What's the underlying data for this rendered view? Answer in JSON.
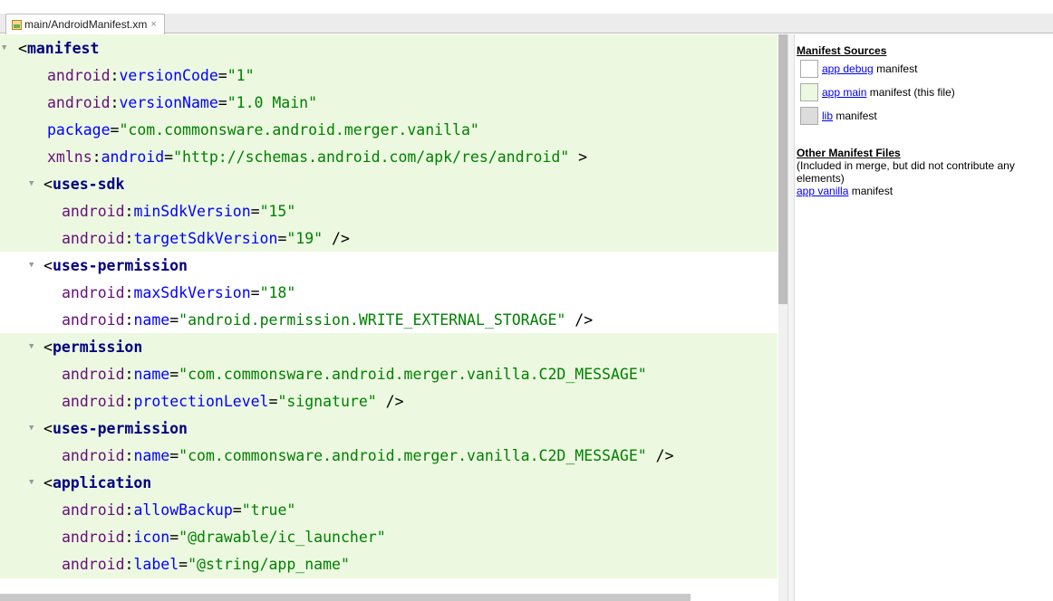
{
  "tab": {
    "title": "main/AndroidManifest.xm",
    "close": "×",
    "icon": "xml-file-icon"
  },
  "code_lines": [
    {
      "bg": "green",
      "fold": true,
      "indent": 0,
      "tokens": [
        {
          "t": "pl",
          "s": "<"
        },
        {
          "t": "tag",
          "s": "manifest"
        }
      ]
    },
    {
      "bg": "green",
      "indent": 1,
      "tokens": [
        {
          "t": "ns",
          "s": "android"
        },
        {
          "t": "pl",
          "s": ":"
        },
        {
          "t": "attr",
          "s": "versionCode"
        },
        {
          "t": "pl",
          "s": "="
        },
        {
          "t": "val",
          "s": "\"1\""
        }
      ]
    },
    {
      "bg": "green",
      "indent": 1,
      "tokens": [
        {
          "t": "ns",
          "s": "android"
        },
        {
          "t": "pl",
          "s": ":"
        },
        {
          "t": "attr",
          "s": "versionName"
        },
        {
          "t": "pl",
          "s": "="
        },
        {
          "t": "val",
          "s": "\"1.0 Main\""
        }
      ]
    },
    {
      "bg": "green",
      "indent": 1,
      "tokens": [
        {
          "t": "attr",
          "s": "package"
        },
        {
          "t": "pl",
          "s": "="
        },
        {
          "t": "val",
          "s": "\"com.commonsware.android.merger.vanilla\""
        }
      ]
    },
    {
      "bg": "green",
      "indent": 1,
      "tokens": [
        {
          "t": "ns",
          "s": "xmlns"
        },
        {
          "t": "pl",
          "s": ":"
        },
        {
          "t": "attr",
          "s": "android"
        },
        {
          "t": "pl",
          "s": "="
        },
        {
          "t": "val",
          "s": "\"http://schemas.android.com/apk/res/android\""
        },
        {
          "t": "pl",
          "s": " >"
        }
      ]
    },
    {
      "bg": "green",
      "fold": true,
      "indent": 1,
      "tokens": [
        {
          "t": "pl",
          "s": "<"
        },
        {
          "t": "tag",
          "s": "uses-sdk"
        }
      ]
    },
    {
      "bg": "green",
      "indent": 2,
      "tokens": [
        {
          "t": "ns",
          "s": "android"
        },
        {
          "t": "pl",
          "s": ":"
        },
        {
          "t": "attr",
          "s": "minSdkVersion"
        },
        {
          "t": "pl",
          "s": "="
        },
        {
          "t": "val",
          "s": "\"15\""
        }
      ]
    },
    {
      "bg": "green",
      "indent": 2,
      "tokens": [
        {
          "t": "ns",
          "s": "android"
        },
        {
          "t": "pl",
          "s": ":"
        },
        {
          "t": "attr",
          "s": "targetSdkVersion"
        },
        {
          "t": "pl",
          "s": "="
        },
        {
          "t": "val",
          "s": "\"19\""
        },
        {
          "t": "pl",
          "s": " />"
        }
      ]
    },
    {
      "bg": "white",
      "fold": true,
      "indent": 1,
      "tokens": [
        {
          "t": "pl",
          "s": "<"
        },
        {
          "t": "tag",
          "s": "uses-permission"
        }
      ]
    },
    {
      "bg": "white",
      "indent": 2,
      "tokens": [
        {
          "t": "ns",
          "s": "android"
        },
        {
          "t": "pl",
          "s": ":"
        },
        {
          "t": "attr",
          "s": "maxSdkVersion"
        },
        {
          "t": "pl",
          "s": "="
        },
        {
          "t": "val",
          "s": "\"18\""
        }
      ]
    },
    {
      "bg": "white",
      "indent": 2,
      "tokens": [
        {
          "t": "ns",
          "s": "android"
        },
        {
          "t": "pl",
          "s": ":"
        },
        {
          "t": "attr",
          "s": "name"
        },
        {
          "t": "pl",
          "s": "="
        },
        {
          "t": "val",
          "s": "\"android.permission.WRITE_EXTERNAL_STORAGE\""
        },
        {
          "t": "pl",
          "s": " />"
        }
      ]
    },
    {
      "bg": "green",
      "fold": true,
      "indent": 1,
      "tokens": [
        {
          "t": "pl",
          "s": "<"
        },
        {
          "t": "tag",
          "s": "permission"
        }
      ]
    },
    {
      "bg": "green",
      "indent": 2,
      "tokens": [
        {
          "t": "ns",
          "s": "android"
        },
        {
          "t": "pl",
          "s": ":"
        },
        {
          "t": "attr",
          "s": "name"
        },
        {
          "t": "pl",
          "s": "="
        },
        {
          "t": "val",
          "s": "\"com.commonsware.android.merger.vanilla.C2D_MESSAGE\""
        }
      ]
    },
    {
      "bg": "green",
      "indent": 2,
      "tokens": [
        {
          "t": "ns",
          "s": "android"
        },
        {
          "t": "pl",
          "s": ":"
        },
        {
          "t": "attr",
          "s": "protectionLevel"
        },
        {
          "t": "pl",
          "s": "="
        },
        {
          "t": "val",
          "s": "\"signature\""
        },
        {
          "t": "pl",
          "s": " />"
        }
      ]
    },
    {
      "bg": "green",
      "fold": true,
      "indent": 1,
      "tokens": [
        {
          "t": "pl",
          "s": "<"
        },
        {
          "t": "tag",
          "s": "uses-permission"
        }
      ]
    },
    {
      "bg": "green",
      "indent": 2,
      "tokens": [
        {
          "t": "ns",
          "s": "android"
        },
        {
          "t": "pl",
          "s": ":"
        },
        {
          "t": "attr",
          "s": "name"
        },
        {
          "t": "pl",
          "s": "="
        },
        {
          "t": "val",
          "s": "\"com.commonsware.android.merger.vanilla.C2D_MESSAGE\""
        },
        {
          "t": "pl",
          "s": " />"
        }
      ]
    },
    {
      "bg": "green",
      "fold": true,
      "indent": 1,
      "tokens": [
        {
          "t": "pl",
          "s": "<"
        },
        {
          "t": "tag",
          "s": "application"
        }
      ]
    },
    {
      "bg": "green",
      "indent": 2,
      "tokens": [
        {
          "t": "ns",
          "s": "android"
        },
        {
          "t": "pl",
          "s": ":"
        },
        {
          "t": "attr",
          "s": "allowBackup"
        },
        {
          "t": "pl",
          "s": "="
        },
        {
          "t": "val",
          "s": "\"true\""
        }
      ]
    },
    {
      "bg": "green",
      "indent": 2,
      "tokens": [
        {
          "t": "ns",
          "s": "android"
        },
        {
          "t": "pl",
          "s": ":"
        },
        {
          "t": "attr",
          "s": "icon"
        },
        {
          "t": "pl",
          "s": "="
        },
        {
          "t": "val",
          "s": "\"@drawable/ic_launcher\""
        }
      ]
    },
    {
      "bg": "green",
      "indent": 2,
      "tokens": [
        {
          "t": "ns",
          "s": "android"
        },
        {
          "t": "pl",
          "s": ":"
        },
        {
          "t": "attr",
          "s": "label"
        },
        {
          "t": "pl",
          "s": "="
        },
        {
          "t": "val",
          "s": "\"@string/app_name\""
        }
      ]
    }
  ],
  "colors": {
    "green_bg": "#ecf9e0",
    "white_bg": "#ffffff",
    "gray_swatch": "#dcdcdc"
  },
  "manifest_sources": {
    "heading": "Manifest Sources",
    "items": [
      {
        "link": "app debug",
        "rest": " manifest",
        "swatch": "white"
      },
      {
        "link": "app main",
        "rest": " manifest (this file)",
        "swatch": "green"
      },
      {
        "link": "lib",
        "rest": " manifest",
        "swatch": "gray"
      }
    ]
  },
  "other_files": {
    "heading": "Other Manifest Files",
    "note": "(Included in merge, but did not contribute any elements)",
    "link": "app vanilla",
    "rest": " manifest"
  }
}
